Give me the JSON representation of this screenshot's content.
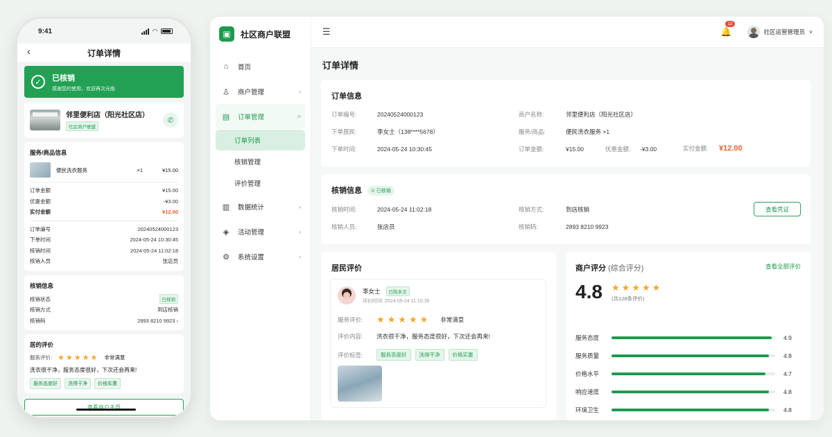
{
  "phone": {
    "time": "9:41",
    "nav_title": "订单详情",
    "status_title": "已核销",
    "status_sub": "感谢您的使用，欢迎再次光临",
    "shop_name": "邻里便利店（阳光社区店）",
    "shop_tag": "社区商户联盟",
    "section_items": "服务/商品信息",
    "item_name": "便民洗衣服务",
    "item_qty": "×1",
    "item_price": "¥15.00",
    "amounts": [
      {
        "k": "订单金额",
        "v": "¥15.00"
      },
      {
        "k": "优惠金额",
        "v": "-¥3.00"
      },
      {
        "k": "实付金额",
        "v": "¥12.00"
      }
    ],
    "order_rows": [
      {
        "k": "订单编号",
        "v": "20240524000123"
      },
      {
        "k": "下单时间",
        "v": "2024-05-24 10:30:45"
      },
      {
        "k": "核销时间",
        "v": "2024-05-24 11:02:18"
      },
      {
        "k": "核销人员",
        "v": "张店员"
      }
    ],
    "verify_title": "核销信息",
    "verify_rows": [
      {
        "k": "核销状态",
        "v": "已核销"
      },
      {
        "k": "核销方式",
        "v": "到店核销"
      },
      {
        "k": "核销码",
        "v": "2893 8210 9923"
      }
    ],
    "review_title": "居的评价",
    "service_label": "服务评价:",
    "stars": "★★★★★",
    "service_text": "非常满意",
    "review_text": "洗衣很干净，服务态度很好，下次还会再来!",
    "tags": [
      "服务态度好",
      "洗得干净",
      "价格实惠"
    ],
    "bottom_button": "查看商户主页"
  },
  "desk": {
    "brand": "社区商户联盟",
    "menu": [
      {
        "label": "首页",
        "icon": "home-icon"
      },
      {
        "label": "商户管理",
        "icon": "user-icon"
      },
      {
        "label": "订单管理",
        "icon": "clipboard-icon"
      },
      {
        "label": "数据统计",
        "icon": "chart-icon"
      },
      {
        "label": "活动管理",
        "icon": "gift-icon"
      },
      {
        "label": "系统设置",
        "icon": "gear-icon"
      }
    ],
    "submenu": [
      "订单列表",
      "核销管理",
      "评价管理"
    ],
    "notif_count": "12",
    "user": "社区运营管理员",
    "page_title": "订单详情",
    "order_card": {
      "title": "订单信息",
      "order_no_k": "订单编号:",
      "order_no_v": "20240524000123",
      "resident_k": "下单居民:",
      "resident_v": "李女士（138****5678）",
      "time_k": "下单时间:",
      "time_v": "2024-05-24 10:30:45",
      "merchant_k": "商户名称:",
      "merchant_v": "邻里便利店（阳光社区店）",
      "service_k": "服务/商品:",
      "service_v": "便民洗衣服务  ×1",
      "amount_k": "订单金额:",
      "amount_v": "¥15.00",
      "discount_k": "优惠金额:",
      "discount_v": "-¥3.00",
      "paid_k": "实付金额:",
      "paid_v": "¥12.00"
    },
    "verify_card": {
      "title": "核销信息",
      "badge": "已核销",
      "time_k": "核销时间:",
      "time_v": "2024-05-24 11:02:18",
      "staff_k": "核销人员:",
      "staff_v": "张店员",
      "method_k": "核销方式:",
      "method_v": "到店核销",
      "code_k": "核销码:",
      "code_v": "2893 8210 9923",
      "button": "查看凭证"
    },
    "review_card": {
      "title": "居民评价",
      "name": "李女士",
      "badge": "已购多次",
      "time": "评价时间: 2024-05-24 11:10:35",
      "service_k": "服务评价:",
      "stars": "★★★★★",
      "service_text": "非常满意",
      "content_k": "评价内容:",
      "content_v": "洗衣很干净，服务态度很好，下次还会再来!",
      "tags_k": "评价标签:",
      "tags": [
        "服务态度好",
        "洗得干净",
        "价格实惠"
      ]
    },
    "rating_card": {
      "title": "商户评分",
      "subtitle": "(综合评分)",
      "link": "查看全部评价",
      "score": "4.8",
      "stars": "★★★★★",
      "count": "(共128条评价)",
      "bars": [
        {
          "label": "服务态度",
          "value": 4.9,
          "text": "4.9"
        },
        {
          "label": "服务质量",
          "value": 4.8,
          "text": "4.8"
        },
        {
          "label": "价格水平",
          "value": 4.7,
          "text": "4.7"
        },
        {
          "label": "响应速度",
          "value": 4.8,
          "text": "4.8"
        },
        {
          "label": "环境卫生",
          "value": 4.8,
          "text": "4.8"
        }
      ],
      "max": 5
    },
    "colors": {
      "accent": "#1e9a4f",
      "price": "#e8602c",
      "star": "#f4a62a"
    }
  }
}
